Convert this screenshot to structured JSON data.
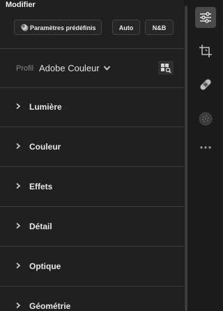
{
  "panel": {
    "title": "Modifier",
    "buttons": {
      "presets": "Paramètres prédéfinis",
      "auto": "Auto",
      "bw": "N&B"
    },
    "profile": {
      "label": "Profil",
      "value": "Adobe Couleur"
    },
    "sections": [
      {
        "label": "Lumière"
      },
      {
        "label": "Couleur"
      },
      {
        "label": "Effets"
      },
      {
        "label": "Détail"
      },
      {
        "label": "Optique"
      },
      {
        "label": "Géométrie"
      }
    ]
  },
  "toolstrip": {
    "tools": [
      {
        "icon": "sliders-icon",
        "active": true
      },
      {
        "icon": "crop-icon",
        "active": false
      },
      {
        "icon": "healing-bandage-icon",
        "active": false
      },
      {
        "icon": "masking-circle-icon",
        "active": false
      },
      {
        "icon": "more-icon",
        "active": false
      }
    ]
  },
  "colors": {
    "background": "#202020",
    "toolstrip": "#1b1b1b",
    "active_tool": "#4a4a4a",
    "text": "#e8e8e8",
    "muted_text": "#8a8a8a"
  }
}
